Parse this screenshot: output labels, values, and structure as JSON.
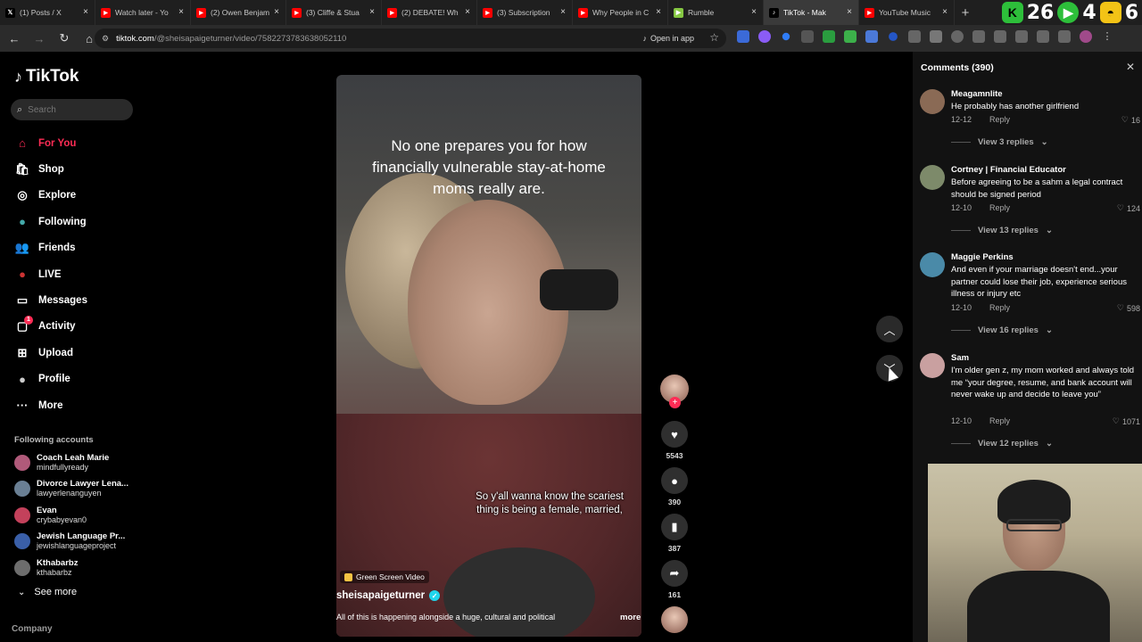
{
  "browser": {
    "tabs": [
      {
        "label": "(1) Posts / X",
        "favicon": "x-icon",
        "color": "#000000"
      },
      {
        "label": "Watch later - Yo",
        "favicon": "youtube-icon",
        "color": "#ff0000"
      },
      {
        "label": "(2) Owen Benjam",
        "favicon": "youtube-icon",
        "color": "#ff0000"
      },
      {
        "label": "(3) Cliffe & Stua",
        "favicon": "youtube-icon",
        "color": "#ff0000"
      },
      {
        "label": "(2) DEBATE! Wh",
        "favicon": "youtube-icon",
        "color": "#ff0000"
      },
      {
        "label": "(3) Subscription",
        "favicon": "youtube-icon",
        "color": "#ff0000"
      },
      {
        "label": "Why People in C",
        "favicon": "youtube-icon",
        "color": "#ff0000"
      },
      {
        "label": "Rumble",
        "favicon": "rumble-icon",
        "color": "#85c742"
      },
      {
        "label": "TikTok - Mak",
        "favicon": "tiktok-icon",
        "color": "#000000",
        "active": true
      },
      {
        "label": "YouTube Music",
        "favicon": "youtube-music-icon",
        "color": "#ff0000"
      }
    ],
    "new_tab": "+",
    "overlay": {
      "k_score": "26",
      "arrow_score": "4",
      "face_score": "6"
    },
    "url_host": "tiktok.com",
    "url_path": "/@sheisapaigeturner/video/7582273783638052110",
    "open_in_app": "Open in app"
  },
  "sidebar": {
    "logo": "TikTok",
    "search_placeholder": "Search",
    "nav": [
      {
        "label": "For You",
        "icon": "home-icon",
        "active": true
      },
      {
        "label": "Shop",
        "icon": "shop-icon"
      },
      {
        "label": "Explore",
        "icon": "compass-icon"
      },
      {
        "label": "Following",
        "icon": "following-avatar-icon"
      },
      {
        "label": "Friends",
        "icon": "friends-icon"
      },
      {
        "label": "LIVE",
        "icon": "live-icon"
      },
      {
        "label": "Messages",
        "icon": "messages-icon"
      },
      {
        "label": "Activity",
        "icon": "activity-icon",
        "badge": "1"
      },
      {
        "label": "Upload",
        "icon": "upload-icon"
      },
      {
        "label": "Profile",
        "icon": "profile-icon"
      },
      {
        "label": "More",
        "icon": "more-icon"
      }
    ],
    "following_title": "Following accounts",
    "accounts": [
      {
        "name": "Coach Leah Marie",
        "handle": "mindfullyready"
      },
      {
        "name": "Divorce Lawyer Lena...",
        "handle": "lawyerlenanguyen"
      },
      {
        "name": "Evan",
        "handle": "crybabyevan0"
      },
      {
        "name": "Jewish Language Pr...",
        "handle": "jewishlanguageproject"
      },
      {
        "name": "Kthabarbz",
        "handle": "kthabarbz"
      }
    ],
    "see_more": "See more",
    "company": "Company"
  },
  "video": {
    "caption_top": "No one prepares you for how financially vulnerable stay-at-home moms really are.",
    "caption_mid": "So y'all wanna know the scariest thing is being a female, married,",
    "tag": "Green Screen Video",
    "author": "sheisapaigeturner",
    "description": "All of this is happening alongside a huge, cultural and political",
    "more": "more"
  },
  "actions": {
    "likes": "5543",
    "comments": "390",
    "saves": "387",
    "shares": "161"
  },
  "comments_panel": {
    "title": "Comments (390)",
    "items": [
      {
        "name": "Meagamnlite",
        "text": "He probably has another girlfriend",
        "date": "12-12",
        "reply": "Reply",
        "likes": "16",
        "replies": "View 3 replies"
      },
      {
        "name": "Cortney | Financial Educator",
        "text": "Before agreeing to be a sahm a legal contract should be signed period",
        "date": "12-10",
        "reply": "Reply",
        "likes": "124",
        "replies": "View 13 replies"
      },
      {
        "name": "Maggie Perkins",
        "text": "And even if your marriage doesn't end...your partner could lose their job, experience serious illness or injury etc",
        "date": "12-10",
        "reply": "Reply",
        "likes": "598",
        "replies": "View 16 replies"
      },
      {
        "name": "Sam",
        "text": "I'm older gen z, my mom worked and always told me “your degree, resume, and bank account will never wake up and decide to leave you”",
        "date": "12-10",
        "reply": "Reply",
        "likes": "1071",
        "replies": "View 12 replies"
      }
    ]
  },
  "colors": {
    "accent": "#fe2c55",
    "verified": "#20d5ec"
  }
}
